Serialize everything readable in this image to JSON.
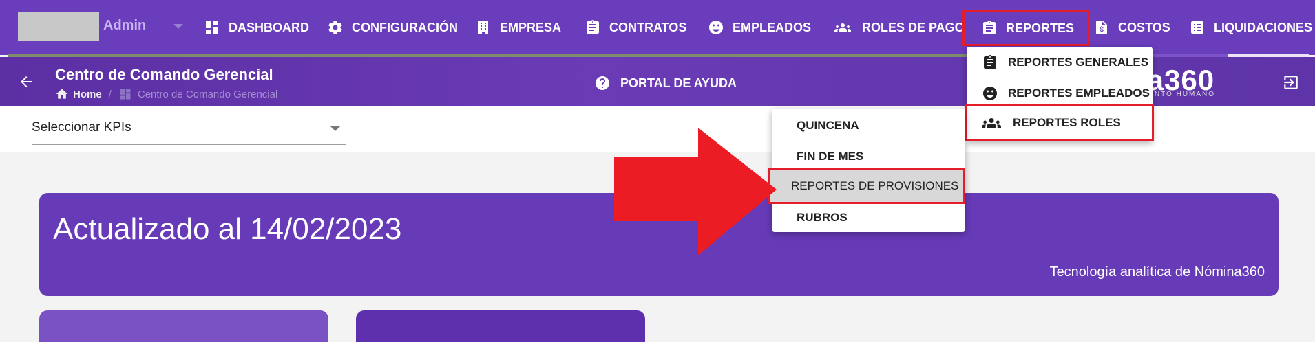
{
  "topbar": {
    "user_name": "Admin",
    "nav": [
      {
        "label": "DASHBOARD",
        "icon": "dashboard-icon"
      },
      {
        "label": "CONFIGURACIÓN",
        "icon": "gear-icon"
      },
      {
        "label": "EMPRESA",
        "icon": "building-icon"
      },
      {
        "label": "CONTRATOS",
        "icon": "clipboard-icon"
      },
      {
        "label": "EMPLEADOS",
        "icon": "face-icon"
      },
      {
        "label": "ROLES DE PAGO",
        "icon": "group-icon"
      },
      {
        "label": "REPORTES",
        "icon": "clipboard-icon"
      },
      {
        "label": "COSTOS",
        "icon": "invoice-icon"
      },
      {
        "label": "LIQUIDACIONES",
        "icon": "list-icon"
      }
    ]
  },
  "subheader": {
    "title": "Centro de Comando Gerencial",
    "breadcrumb": {
      "home": "Home",
      "current": "Centro de Comando Gerencial"
    },
    "help_label": "PORTAL DE AYUDA",
    "brand": "na360",
    "brand_sub": "ALENTO HUMANO"
  },
  "toolbar": {
    "kpi_placeholder": "Seleccionar KPIs"
  },
  "banner": {
    "heading": "Actualizado al 14/02/2023",
    "footer": "Tecnología analítica de Nómina360"
  },
  "reportes_menu": [
    {
      "label": "REPORTES GENERALES",
      "icon": "clipboard-icon"
    },
    {
      "label": "REPORTES EMPLEADOS",
      "icon": "face-icon"
    },
    {
      "label": "REPORTES ROLES",
      "icon": "group-icon"
    }
  ],
  "roles_submenu": [
    {
      "label": "QUINCENA"
    },
    {
      "label": "FIN DE MES"
    },
    {
      "label": "REPORTES DE PROVISIONES"
    },
    {
      "label": "RUBROS"
    }
  ],
  "colors": {
    "primary": "#673ab7",
    "highlight_box": "#e51c2a",
    "arrow": "#ec1c24"
  }
}
